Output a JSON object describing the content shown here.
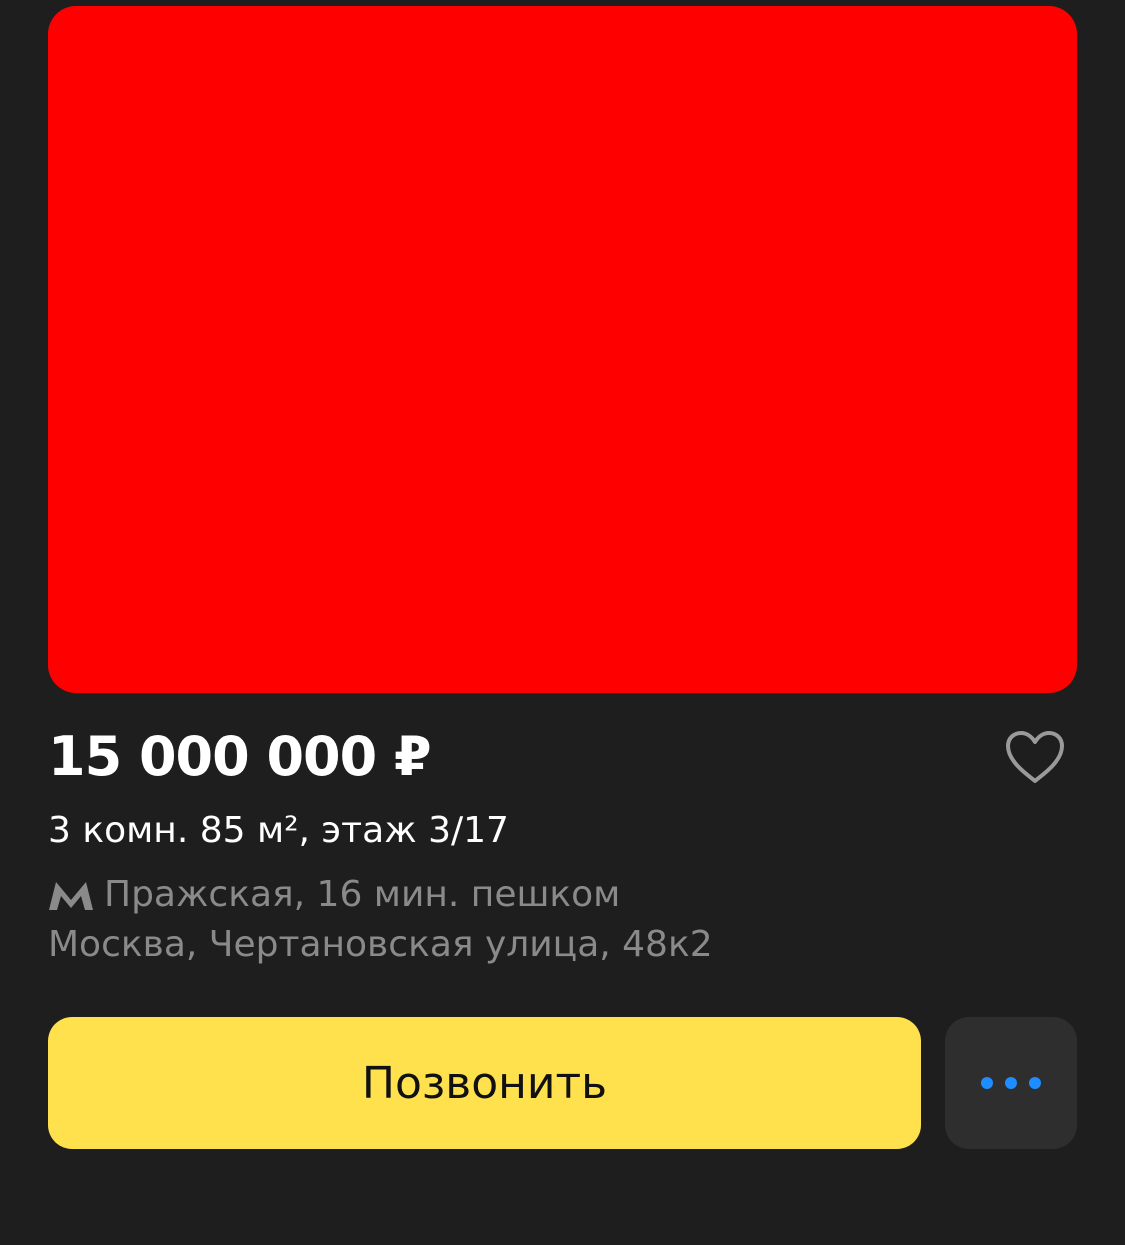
{
  "listing": {
    "photo_color": "#ff0000",
    "price": "15 000 000 ₽",
    "summary": "3 комн. 85 м², этаж 3/17",
    "metro": {
      "icon": "metro-icon",
      "text": "Пражская, 16 мин. пешком"
    },
    "address": "Москва, Чертановская улица, 48к2"
  },
  "actions": {
    "call_label": "Позвонить",
    "favorite_icon": "heart-icon",
    "more_icon": "more-dots-icon"
  },
  "colors": {
    "background": "#1e1e1e",
    "call_button": "#ffe04d",
    "more_button": "#2e2e2e",
    "dots_accent": "#1e8dff",
    "secondary_text": "#8a8a8a"
  }
}
